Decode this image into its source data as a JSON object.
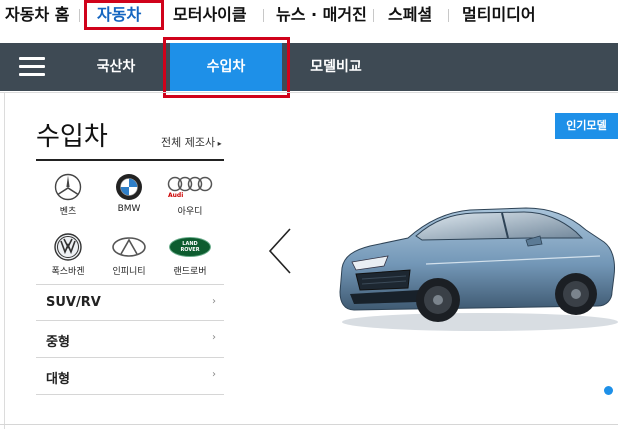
{
  "top_nav": {
    "items": [
      {
        "label": "자동차 홈"
      },
      {
        "label": "자동차"
      },
      {
        "label": "모터사이클"
      },
      {
        "label": "뉴스 · 매거진"
      },
      {
        "label": "스페셜"
      },
      {
        "label": "멀티미디어"
      }
    ],
    "active_index": 1
  },
  "sub_nav": {
    "menu_icon": "hamburger-icon",
    "tabs": [
      {
        "label": "국산차"
      },
      {
        "label": "수입차"
      },
      {
        "label": "모델비교"
      }
    ],
    "active_index": 1
  },
  "panel": {
    "title": "수입차",
    "all_makers_link": "전체 제조사",
    "brands": [
      {
        "name": "벤츠",
        "icon": "mercedes-benz-logo"
      },
      {
        "name": "BMW",
        "icon": "bmw-logo"
      },
      {
        "name": "아우디",
        "icon": "audi-logo",
        "logo_text": "Audi"
      },
      {
        "name": "폭스바겐",
        "icon": "volkswagen-logo"
      },
      {
        "name": "인피니티",
        "icon": "infiniti-logo"
      },
      {
        "name": "랜드로버",
        "icon": "land-rover-logo",
        "logo_text": "LAND ROVER"
      }
    ],
    "categories": [
      {
        "label": "SUV/RV"
      },
      {
        "label": "중형"
      },
      {
        "label": "대형"
      }
    ]
  },
  "hero": {
    "popular_models_button": "인기모델",
    "prev_icon": "chevron-left-icon",
    "image": "car-photo"
  },
  "colors": {
    "accent_blue": "#1e90e8",
    "active_text_blue": "#1565c0",
    "dark_bar": "#3e4a54",
    "highlight_red": "#d0021b"
  }
}
